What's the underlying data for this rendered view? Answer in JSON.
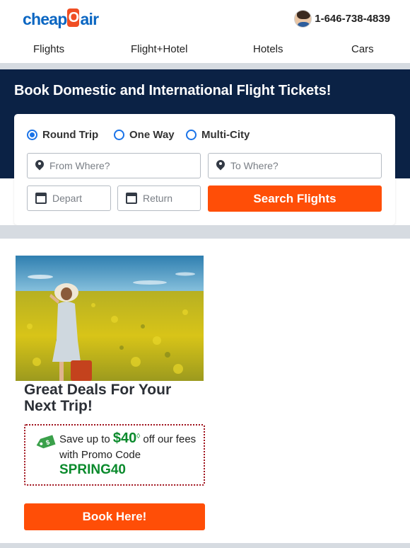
{
  "header": {
    "logo": {
      "part1": "cheap",
      "part2": "O",
      "part3": "air"
    },
    "phone": "1-646-738-4839"
  },
  "nav": {
    "items": [
      {
        "label": "Flights"
      },
      {
        "label": "Flight+Hotel"
      },
      {
        "label": "Hotels"
      },
      {
        "label": "Cars"
      }
    ]
  },
  "hero": {
    "title": "Book Domestic and International Flight Tickets!"
  },
  "search": {
    "trip_types": [
      {
        "label": "Round Trip",
        "selected": true
      },
      {
        "label": "One Way",
        "selected": false
      },
      {
        "label": "Multi-City",
        "selected": false
      }
    ],
    "from_placeholder": "From Where?",
    "to_placeholder": "To Where?",
    "depart_placeholder": "Depart",
    "return_placeholder": "Return",
    "button_label": "Search Flights"
  },
  "promo": {
    "title": "Great Deals For Your Next Trip!",
    "save_prefix": "Save up to ",
    "amount": "$40",
    "dagger": "◊",
    "save_suffix": " off our fees",
    "code_label": "with Promo Code",
    "code": "SPRING40",
    "tag_text": "$",
    "button_label": "Book Here!"
  },
  "colors": {
    "brand_blue": "#0a66c2",
    "accent_orange": "#ff4e07",
    "hero_navy": "#0b2245",
    "promo_green": "#0a8a2c",
    "promo_border": "#a0121c"
  },
  "icons": [
    "agent-avatar-icon",
    "location-pin-icon",
    "calendar-icon",
    "price-tag-icon",
    "radio-icon"
  ]
}
